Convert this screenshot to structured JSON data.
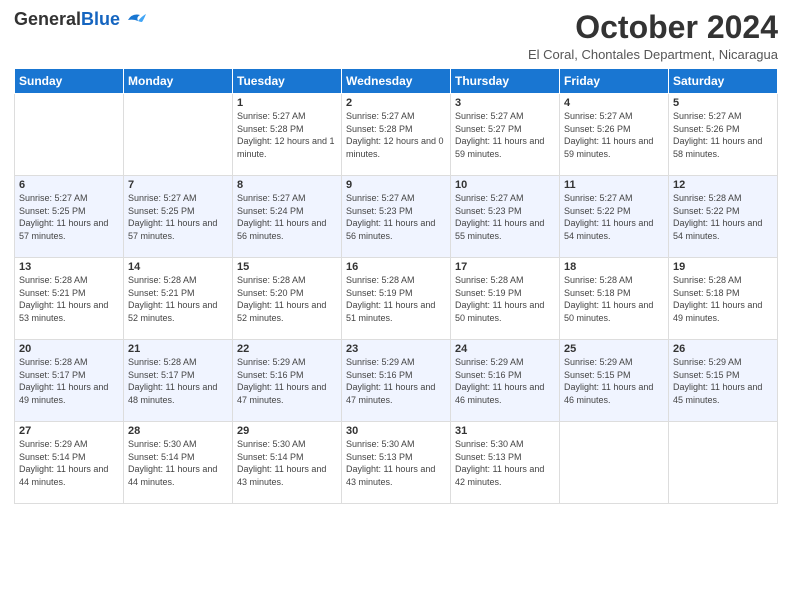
{
  "header": {
    "logo_general": "General",
    "logo_blue": "Blue",
    "month_title": "October 2024",
    "location": "El Coral, Chontales Department, Nicaragua"
  },
  "days_of_week": [
    "Sunday",
    "Monday",
    "Tuesday",
    "Wednesday",
    "Thursday",
    "Friday",
    "Saturday"
  ],
  "weeks": [
    [
      {
        "day": "",
        "sunrise": "",
        "sunset": "",
        "daylight": ""
      },
      {
        "day": "",
        "sunrise": "",
        "sunset": "",
        "daylight": ""
      },
      {
        "day": "1",
        "sunrise": "Sunrise: 5:27 AM",
        "sunset": "Sunset: 5:28 PM",
        "daylight": "Daylight: 12 hours and 1 minute."
      },
      {
        "day": "2",
        "sunrise": "Sunrise: 5:27 AM",
        "sunset": "Sunset: 5:28 PM",
        "daylight": "Daylight: 12 hours and 0 minutes."
      },
      {
        "day": "3",
        "sunrise": "Sunrise: 5:27 AM",
        "sunset": "Sunset: 5:27 PM",
        "daylight": "Daylight: 11 hours and 59 minutes."
      },
      {
        "day": "4",
        "sunrise": "Sunrise: 5:27 AM",
        "sunset": "Sunset: 5:26 PM",
        "daylight": "Daylight: 11 hours and 59 minutes."
      },
      {
        "day": "5",
        "sunrise": "Sunrise: 5:27 AM",
        "sunset": "Sunset: 5:26 PM",
        "daylight": "Daylight: 11 hours and 58 minutes."
      }
    ],
    [
      {
        "day": "6",
        "sunrise": "Sunrise: 5:27 AM",
        "sunset": "Sunset: 5:25 PM",
        "daylight": "Daylight: 11 hours and 57 minutes."
      },
      {
        "day": "7",
        "sunrise": "Sunrise: 5:27 AM",
        "sunset": "Sunset: 5:25 PM",
        "daylight": "Daylight: 11 hours and 57 minutes."
      },
      {
        "day": "8",
        "sunrise": "Sunrise: 5:27 AM",
        "sunset": "Sunset: 5:24 PM",
        "daylight": "Daylight: 11 hours and 56 minutes."
      },
      {
        "day": "9",
        "sunrise": "Sunrise: 5:27 AM",
        "sunset": "Sunset: 5:23 PM",
        "daylight": "Daylight: 11 hours and 56 minutes."
      },
      {
        "day": "10",
        "sunrise": "Sunrise: 5:27 AM",
        "sunset": "Sunset: 5:23 PM",
        "daylight": "Daylight: 11 hours and 55 minutes."
      },
      {
        "day": "11",
        "sunrise": "Sunrise: 5:27 AM",
        "sunset": "Sunset: 5:22 PM",
        "daylight": "Daylight: 11 hours and 54 minutes."
      },
      {
        "day": "12",
        "sunrise": "Sunrise: 5:28 AM",
        "sunset": "Sunset: 5:22 PM",
        "daylight": "Daylight: 11 hours and 54 minutes."
      }
    ],
    [
      {
        "day": "13",
        "sunrise": "Sunrise: 5:28 AM",
        "sunset": "Sunset: 5:21 PM",
        "daylight": "Daylight: 11 hours and 53 minutes."
      },
      {
        "day": "14",
        "sunrise": "Sunrise: 5:28 AM",
        "sunset": "Sunset: 5:21 PM",
        "daylight": "Daylight: 11 hours and 52 minutes."
      },
      {
        "day": "15",
        "sunrise": "Sunrise: 5:28 AM",
        "sunset": "Sunset: 5:20 PM",
        "daylight": "Daylight: 11 hours and 52 minutes."
      },
      {
        "day": "16",
        "sunrise": "Sunrise: 5:28 AM",
        "sunset": "Sunset: 5:19 PM",
        "daylight": "Daylight: 11 hours and 51 minutes."
      },
      {
        "day": "17",
        "sunrise": "Sunrise: 5:28 AM",
        "sunset": "Sunset: 5:19 PM",
        "daylight": "Daylight: 11 hours and 50 minutes."
      },
      {
        "day": "18",
        "sunrise": "Sunrise: 5:28 AM",
        "sunset": "Sunset: 5:18 PM",
        "daylight": "Daylight: 11 hours and 50 minutes."
      },
      {
        "day": "19",
        "sunrise": "Sunrise: 5:28 AM",
        "sunset": "Sunset: 5:18 PM",
        "daylight": "Daylight: 11 hours and 49 minutes."
      }
    ],
    [
      {
        "day": "20",
        "sunrise": "Sunrise: 5:28 AM",
        "sunset": "Sunset: 5:17 PM",
        "daylight": "Daylight: 11 hours and 49 minutes."
      },
      {
        "day": "21",
        "sunrise": "Sunrise: 5:28 AM",
        "sunset": "Sunset: 5:17 PM",
        "daylight": "Daylight: 11 hours and 48 minutes."
      },
      {
        "day": "22",
        "sunrise": "Sunrise: 5:29 AM",
        "sunset": "Sunset: 5:16 PM",
        "daylight": "Daylight: 11 hours and 47 minutes."
      },
      {
        "day": "23",
        "sunrise": "Sunrise: 5:29 AM",
        "sunset": "Sunset: 5:16 PM",
        "daylight": "Daylight: 11 hours and 47 minutes."
      },
      {
        "day": "24",
        "sunrise": "Sunrise: 5:29 AM",
        "sunset": "Sunset: 5:16 PM",
        "daylight": "Daylight: 11 hours and 46 minutes."
      },
      {
        "day": "25",
        "sunrise": "Sunrise: 5:29 AM",
        "sunset": "Sunset: 5:15 PM",
        "daylight": "Daylight: 11 hours and 46 minutes."
      },
      {
        "day": "26",
        "sunrise": "Sunrise: 5:29 AM",
        "sunset": "Sunset: 5:15 PM",
        "daylight": "Daylight: 11 hours and 45 minutes."
      }
    ],
    [
      {
        "day": "27",
        "sunrise": "Sunrise: 5:29 AM",
        "sunset": "Sunset: 5:14 PM",
        "daylight": "Daylight: 11 hours and 44 minutes."
      },
      {
        "day": "28",
        "sunrise": "Sunrise: 5:30 AM",
        "sunset": "Sunset: 5:14 PM",
        "daylight": "Daylight: 11 hours and 44 minutes."
      },
      {
        "day": "29",
        "sunrise": "Sunrise: 5:30 AM",
        "sunset": "Sunset: 5:14 PM",
        "daylight": "Daylight: 11 hours and 43 minutes."
      },
      {
        "day": "30",
        "sunrise": "Sunrise: 5:30 AM",
        "sunset": "Sunset: 5:13 PM",
        "daylight": "Daylight: 11 hours and 43 minutes."
      },
      {
        "day": "31",
        "sunrise": "Sunrise: 5:30 AM",
        "sunset": "Sunset: 5:13 PM",
        "daylight": "Daylight: 11 hours and 42 minutes."
      },
      {
        "day": "",
        "sunrise": "",
        "sunset": "",
        "daylight": ""
      },
      {
        "day": "",
        "sunrise": "",
        "sunset": "",
        "daylight": ""
      }
    ]
  ]
}
